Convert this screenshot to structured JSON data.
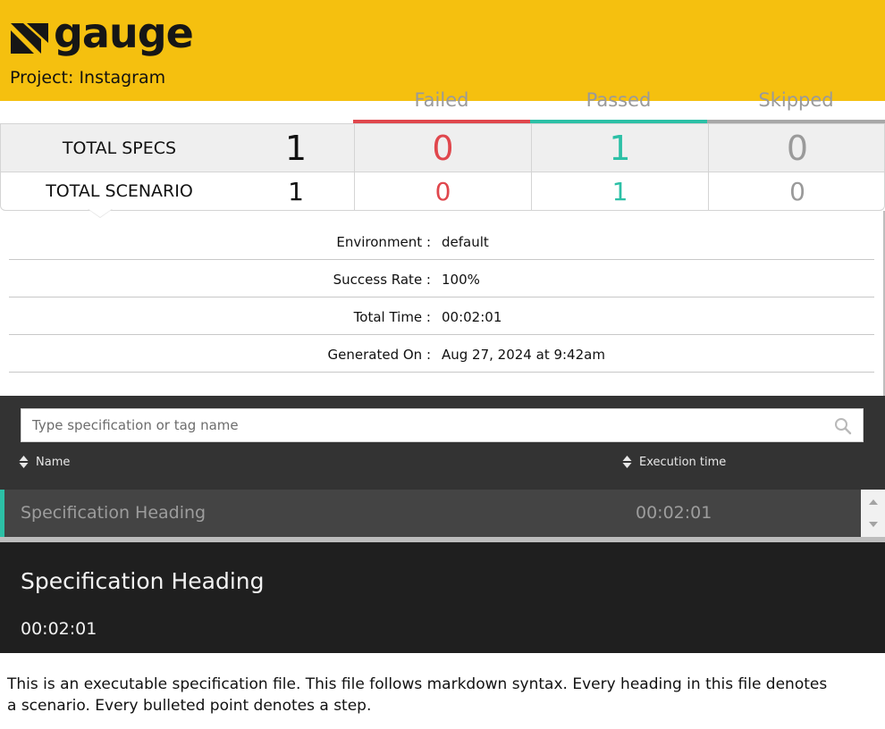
{
  "header": {
    "brand": "gauge",
    "project": "Project: Instagram",
    "logo_icon": "gauge-logo-icon",
    "background": "#f5c00f"
  },
  "summary": {
    "status_headers": {
      "failed": "Failed",
      "passed": "Passed",
      "skipped": "Skipped"
    },
    "colors": {
      "failed": "#e0474d",
      "passed": "#2cc0a6",
      "skipped": "#a8a8a8"
    },
    "specs": {
      "label": "TOTAL SPECS",
      "total": "1",
      "failed": "0",
      "passed": "1",
      "skipped": "0"
    },
    "scenarios": {
      "label": "TOTAL SCENARIO",
      "total": "1",
      "failed": "0",
      "passed": "1",
      "skipped": "0"
    }
  },
  "info": [
    {
      "key": "Environment :",
      "value": "default"
    },
    {
      "key": "Success Rate :",
      "value": "100%"
    },
    {
      "key": "Total Time :",
      "value": "00:02:01"
    },
    {
      "key": "Generated On :",
      "value": "Aug 27, 2024 at 9:42am"
    }
  ],
  "search": {
    "placeholder": "Type specification or tag name",
    "icon": "search-icon"
  },
  "list": {
    "columns": {
      "name": "Name",
      "execution_time": "Execution time"
    },
    "rows": [
      {
        "name": "Specification Heading",
        "time": "00:02:01",
        "status": "passed"
      }
    ]
  },
  "detail": {
    "title": "Specification Heading",
    "time": "00:02:01",
    "description": "This is an executable specification file. This file follows markdown syntax. Every heading in this file denotes a scenario. Every bulleted point denotes a step."
  }
}
